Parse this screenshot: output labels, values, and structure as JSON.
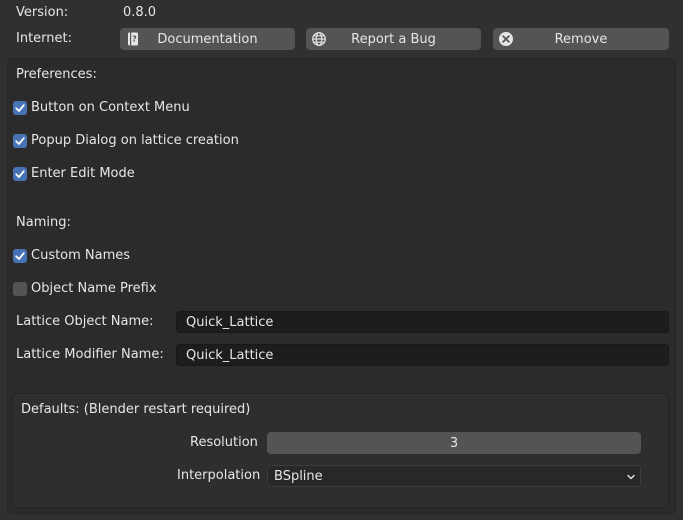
{
  "header": {
    "version_label": "Version:",
    "version_value": "0.8.0",
    "internet_label": "Internet:",
    "buttons": {
      "documentation": "Documentation",
      "report_bug": "Report a Bug",
      "remove": "Remove"
    }
  },
  "preferences": {
    "title": "Preferences:",
    "options": [
      {
        "label": "Button on Context Menu",
        "checked": true
      },
      {
        "label": "Popup Dialog on lattice creation",
        "checked": true
      },
      {
        "label": "Enter Edit Mode",
        "checked": true
      }
    ]
  },
  "naming": {
    "title": "Naming:",
    "options": [
      {
        "label": "Custom Names",
        "checked": true
      },
      {
        "label": "Object Name Prefix",
        "checked": false
      }
    ],
    "lattice_object_name": {
      "label": "Lattice Object Name:",
      "value": "Quick_Lattice"
    },
    "lattice_modifier_name": {
      "label": "Lattice Modifier Name:",
      "value": "Quick_Lattice"
    }
  },
  "defaults": {
    "title": "Defaults: (Blender restart required)",
    "resolution": {
      "label": "Resolution",
      "value": "3"
    },
    "interpolation": {
      "label": "Interpolation",
      "value": "BSpline"
    }
  },
  "colors": {
    "background": "#303030",
    "accent_checkbox": "#4772b3",
    "button": "#545454",
    "field": "#1d1d1d"
  }
}
